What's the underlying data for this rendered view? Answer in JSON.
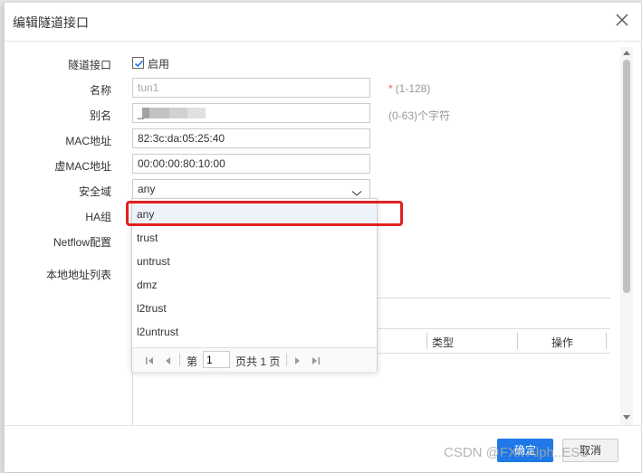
{
  "dialog": {
    "title": "编辑隧道接口"
  },
  "form": {
    "tunnel_label": "隧道接口",
    "enable_label": "启用",
    "enable_checked": true,
    "name_label": "名称",
    "name_value": "tun1",
    "name_hint_required": "*",
    "name_hint": "(1-128)",
    "alias_label": "别名",
    "alias_value": "_",
    "alias_hint": "(0-63)个字符",
    "mac_label": "MAC地址",
    "mac_value": "82:3c:da:05:25:40",
    "vmac_label": "虚MAC地址",
    "vmac_value": "00:00:00:80:10:00",
    "zone_label": "安全域",
    "zone_value": "any",
    "ha_label": "HA组",
    "netflow_label": "Netflow配置",
    "local_addr_label": "本地地址列表"
  },
  "dropdown": {
    "options": [
      "any",
      "trust",
      "untrust",
      "dmz",
      "l2trust",
      "l2untrust"
    ],
    "selected_index": 0,
    "pager": {
      "page_prefix": "第",
      "page_value": "1",
      "page_suffix": "页共 1 页"
    }
  },
  "table": {
    "columns": [
      "类型",
      "操作"
    ]
  },
  "footer": {
    "ok_label": "确定",
    "cancel_label": "取消"
  },
  "watermark": "CSDN @FXx Alph..ESS",
  "colors": {
    "primary": "#1e78e8",
    "highlight": "#e02020",
    "selected_bg": "#eef3fa"
  }
}
